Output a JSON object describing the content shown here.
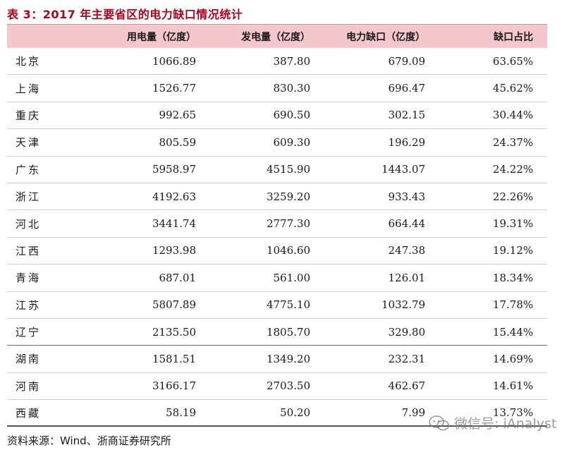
{
  "title": "表 3：2017 年主要省区的电力缺口情况统计",
  "header": {
    "col1": "用电量（亿度）",
    "col2": "发电量（亿度）",
    "col3": "电力缺口（亿度）",
    "col4": "缺口占比"
  },
  "rows": [
    {
      "region": "北京",
      "consumption": "1066.89",
      "generation": "387.80",
      "gap": "679.09",
      "ratio": "63.65%"
    },
    {
      "region": "上海",
      "consumption": "1526.77",
      "generation": "830.30",
      "gap": "696.47",
      "ratio": "45.62%"
    },
    {
      "region": "重庆",
      "consumption": "992.65",
      "generation": "690.50",
      "gap": "302.15",
      "ratio": "30.44%"
    },
    {
      "region": "天津",
      "consumption": "805.59",
      "generation": "609.30",
      "gap": "196.29",
      "ratio": "24.37%"
    },
    {
      "region": "广东",
      "consumption": "5958.97",
      "generation": "4515.90",
      "gap": "1443.07",
      "ratio": "24.22%"
    },
    {
      "region": "浙江",
      "consumption": "4192.63",
      "generation": "3259.20",
      "gap": "933.43",
      "ratio": "22.26%"
    },
    {
      "region": "河北",
      "consumption": "3441.74",
      "generation": "2777.30",
      "gap": "664.44",
      "ratio": "19.31%"
    },
    {
      "region": "江西",
      "consumption": "1293.98",
      "generation": "1046.60",
      "gap": "247.38",
      "ratio": "19.12%"
    },
    {
      "region": "青海",
      "consumption": "687.01",
      "generation": "561.00",
      "gap": "126.01",
      "ratio": "18.34%"
    },
    {
      "region": "江苏",
      "consumption": "5807.89",
      "generation": "4775.10",
      "gap": "1032.79",
      "ratio": "17.78%"
    },
    {
      "region": "辽宁",
      "consumption": "2135.50",
      "generation": "1805.70",
      "gap": "329.80",
      "ratio": "15.44%"
    },
    {
      "region": "湖南",
      "consumption": "1581.51",
      "generation": "1349.20",
      "gap": "232.31",
      "ratio": "14.69%"
    },
    {
      "region": "河南",
      "consumption": "3166.17",
      "generation": "2703.50",
      "gap": "462.67",
      "ratio": "14.61%"
    },
    {
      "region": "西藏",
      "consumption": "58.19",
      "generation": "50.20",
      "gap": "7.99",
      "ratio": "13.73%"
    }
  ],
  "source": "资料来源：Wind、浙商证券研究所",
  "watermark": {
    "text": "微信号: iAnalyst",
    "icon": "wechat-icon"
  }
}
